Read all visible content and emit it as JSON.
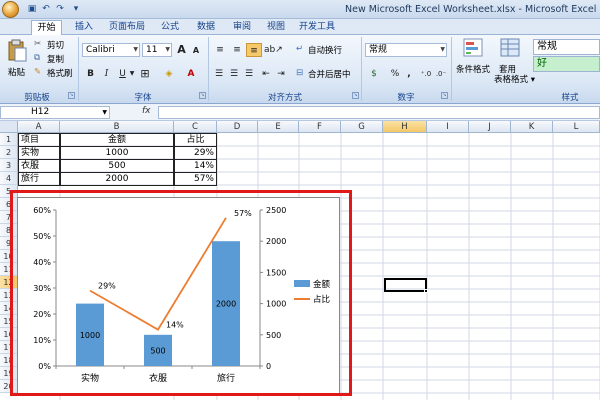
{
  "window": {
    "title": "New Microsoft Excel Worksheet.xlsx - Microsoft Excel"
  },
  "tabs": [
    "开始",
    "插入",
    "页面布局",
    "公式",
    "数据",
    "审阅",
    "视图",
    "开发工具"
  ],
  "ribbon": {
    "clipboard": {
      "paste": "粘贴",
      "cut": "剪切",
      "copy": "复制",
      "format_painter": "格式刷",
      "group": "剪贴板"
    },
    "font": {
      "name": "Calibri",
      "size": "11",
      "grow": "A",
      "shrink": "A",
      "bold": "B",
      "italic": "I",
      "underline": "U",
      "group": "字体"
    },
    "alignment": {
      "wrap": "自动换行",
      "merge": "合并后居中",
      "group": "对齐方式"
    },
    "number": {
      "format": "常规",
      "currency": "$",
      "percent": "%",
      "comma": ",",
      "group": "数字"
    },
    "styles": {
      "conditional": "条件格式",
      "table_format": "套用\n表格格式",
      "style_normal": "常规",
      "style_good": "好",
      "group": "样式"
    }
  },
  "formula_bar": {
    "name_box": "H12",
    "fx": "fx",
    "formula": ""
  },
  "columns": [
    "A",
    "B",
    "C",
    "D",
    "E",
    "F",
    "G",
    "H",
    "I",
    "J",
    "K",
    "L"
  ],
  "rows": [
    "1",
    "2",
    "3",
    "4",
    "5",
    "6",
    "7",
    "8",
    "9",
    "10",
    "11",
    "12",
    "13",
    "14",
    "15",
    "16",
    "17",
    "18",
    "19",
    "20"
  ],
  "selected_cell": "H12",
  "table": {
    "headers": [
      "项目",
      "金额",
      "占比"
    ],
    "rows": [
      [
        "实物",
        "1000",
        "29%"
      ],
      [
        "衣服",
        "500",
        "14%"
      ],
      [
        "旅行",
        "2000",
        "57%"
      ]
    ]
  },
  "chart_data": {
    "type": "bar",
    "categories": [
      "实物",
      "衣服",
      "旅行"
    ],
    "series": [
      {
        "name": "金额",
        "type": "bar",
        "axis": "right",
        "values": [
          1000,
          500,
          2000
        ],
        "color": "#5b9bd5",
        "labels": [
          "1000",
          "500",
          "2000"
        ]
      },
      {
        "name": "占比",
        "type": "line",
        "axis": "left",
        "values": [
          0.29,
          0.14,
          0.57
        ],
        "color": "#ed7d31",
        "labels": [
          "29%",
          "14%",
          "57%"
        ]
      }
    ],
    "left_axis": {
      "ylim": [
        0,
        0.6
      ],
      "ticks": [
        "0%",
        "10%",
        "20%",
        "30%",
        "40%",
        "50%",
        "60%"
      ]
    },
    "right_axis": {
      "ylim": [
        0,
        2500
      ],
      "ticks": [
        "0",
        "500",
        "1000",
        "1500",
        "2000",
        "2500"
      ]
    },
    "legend": "right",
    "grid": false
  },
  "colors": {
    "accent": "#15428b",
    "highlight_frame": "#e01818"
  }
}
